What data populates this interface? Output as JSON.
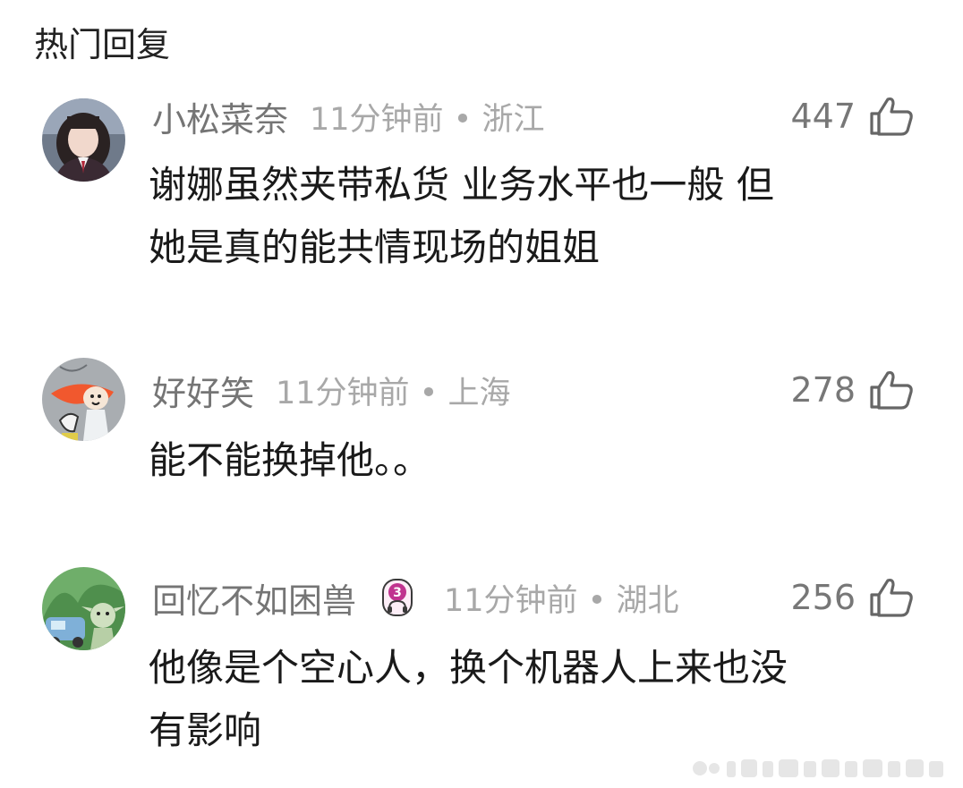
{
  "section_title": "热门回复",
  "comments": [
    {
      "username": "小松菜奈",
      "time_location": "11分钟前 • 浙江",
      "likes": "447",
      "lines": [
        "谢娜虽然夹带私货 业务水平也一般 但",
        "她是真的能共情现场的姐姐"
      ],
      "avatar_icon": "avatar-girl-school-uniform"
    },
    {
      "username": "好好笑",
      "time_location": "11分钟前 • 上海",
      "likes": "278",
      "lines": [
        "能不能换掉他。。"
      ],
      "avatar_icon": "avatar-cartoon-red-hair"
    },
    {
      "username": "回忆不如困兽",
      "badge_text": "3",
      "time_location": "11分钟前 • 湖北",
      "likes": "256",
      "lines": [
        "他像是个空心人，换个机器人上来也没",
        "有影响"
      ],
      "avatar_icon": "avatar-cartoon-goblin-car"
    }
  ],
  "colors": {
    "username": "#757575",
    "meta": "#a8a8a8",
    "body": "#1a1a1a",
    "badge_accent": "#c0338f"
  }
}
